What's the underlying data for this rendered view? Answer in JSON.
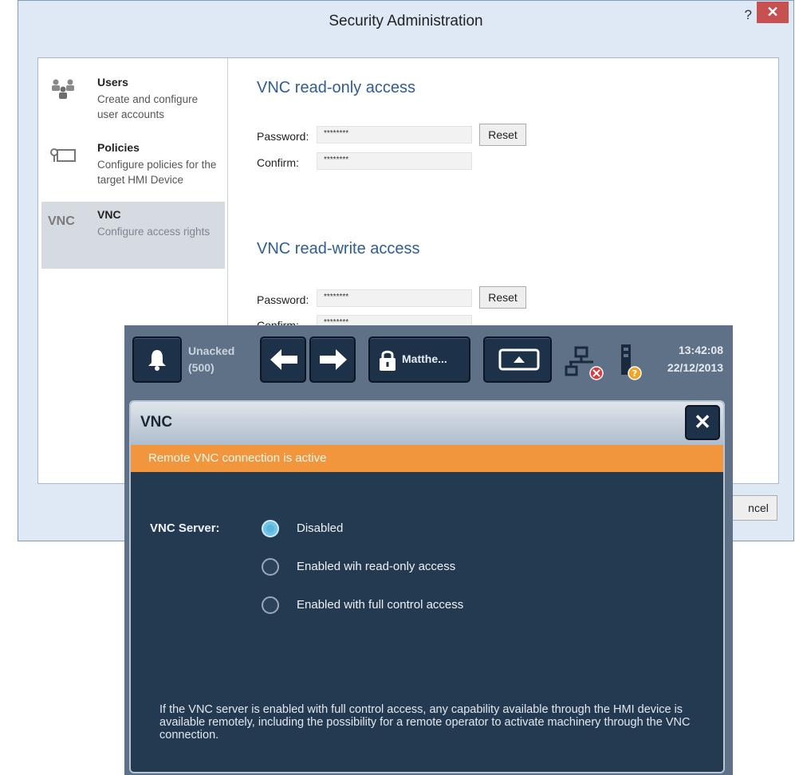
{
  "window": {
    "title": "Security Administration",
    "help": "?",
    "close": "✕",
    "cancel_fragment": "ncel"
  },
  "nav": {
    "items": [
      {
        "icon": "users-icon",
        "title": "Users",
        "desc": "Create and configure user accounts",
        "selected": false
      },
      {
        "icon": "policies-icon",
        "title": "Policies",
        "desc": "Configure policies for the target HMI Device",
        "selected": false
      },
      {
        "icon": "vnc-icon",
        "icon_text": "VNC",
        "title": "VNC",
        "desc": "Configure access rights",
        "selected": true
      }
    ]
  },
  "readonly": {
    "title": "VNC read-only access",
    "password_label": "Password:",
    "password_value": "********",
    "confirm_label": "Confirm:",
    "confirm_value": "********",
    "reset_label": "Reset"
  },
  "readwrite": {
    "title": "VNC read-write access",
    "password_label": "Password:",
    "password_value": "********",
    "confirm_label": "Confirm:",
    "confirm_value": "********",
    "reset_label": "Reset"
  },
  "hmi": {
    "alarm_line1": "Unacked",
    "alarm_line2": "(500)",
    "user_label": "Matthe...",
    "time": "13:42:08",
    "date": "22/12/2013",
    "dialog": {
      "title": "VNC",
      "close": "✕",
      "banner": "Remote VNC connection is active",
      "server_label": "VNC Server:",
      "options": [
        {
          "label": "Disabled",
          "selected": true
        },
        {
          "label": "Enabled wih read-only access",
          "selected": false
        },
        {
          "label": "Enabled with full control access",
          "selected": false
        }
      ],
      "warning": "If the VNC server is enabled with full control access, any capability available through the HMI device is available remotely, including the possibility for a remote operator to activate machinery through the VNC connection."
    }
  },
  "colors": {
    "accent_title": "#2e5d99",
    "banner": "#f1963c",
    "hmi_dialog_bg": "#233a51",
    "window_close": "#c75050"
  }
}
